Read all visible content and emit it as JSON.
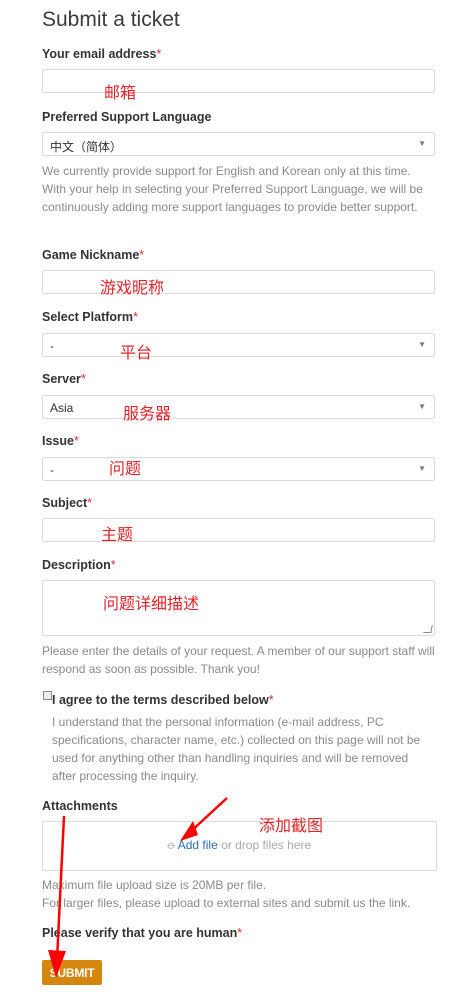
{
  "page": {
    "title": "Submit a ticket"
  },
  "email": {
    "label": "Your email address",
    "required": "*",
    "annotation": "邮箱"
  },
  "language": {
    "label": "Preferred Support Language",
    "value": "中文（简体）",
    "help": "We currently provide support for English and Korean only at this time. With your help in selecting your Preferred Support Language, we will be continuously adding more support languages to provide better support."
  },
  "nickname": {
    "label": "Game Nickname",
    "required": "*",
    "annotation": "游戏昵称"
  },
  "platform": {
    "label": "Select Platform",
    "required": "*",
    "value": "-",
    "annotation": "平台"
  },
  "server": {
    "label": "Server",
    "required": "*",
    "value": "Asia",
    "annotation": "服务器"
  },
  "issue": {
    "label": "Issue",
    "required": "*",
    "value": "-",
    "annotation": "问题"
  },
  "subject": {
    "label": "Subject",
    "required": "*",
    "annotation": "主题"
  },
  "description": {
    "label": "Description",
    "required": "*",
    "annotation": "问题详细描述",
    "help": "Please enter the details of your request. A member of our support staff will respond as soon as possible. Thank you!"
  },
  "terms": {
    "label": "I agree to the terms described below",
    "required": "*",
    "text": "I understand that the personal information (e-mail address, PC specifications, character name, etc.) collected on this page will not be used for anything other than handling inquiries and will be removed after processing the inquiry."
  },
  "attachments": {
    "label": "Attachments",
    "add_file": "Add file",
    "drop_text": " or drop files here",
    "annotation": "添加截图",
    "help1": "Maximum file upload size is 20MB per file.",
    "help2": "For larger files, please upload to external sites and submit us the link."
  },
  "verify": {
    "label": "Please verify that you are human",
    "required": "*"
  },
  "submit": {
    "label": "SUBMIT"
  },
  "colors": {
    "required": "#d9302f",
    "annotation": "#e0252a",
    "submit_bg": "#d4860e",
    "link": "#2a6fb8"
  }
}
